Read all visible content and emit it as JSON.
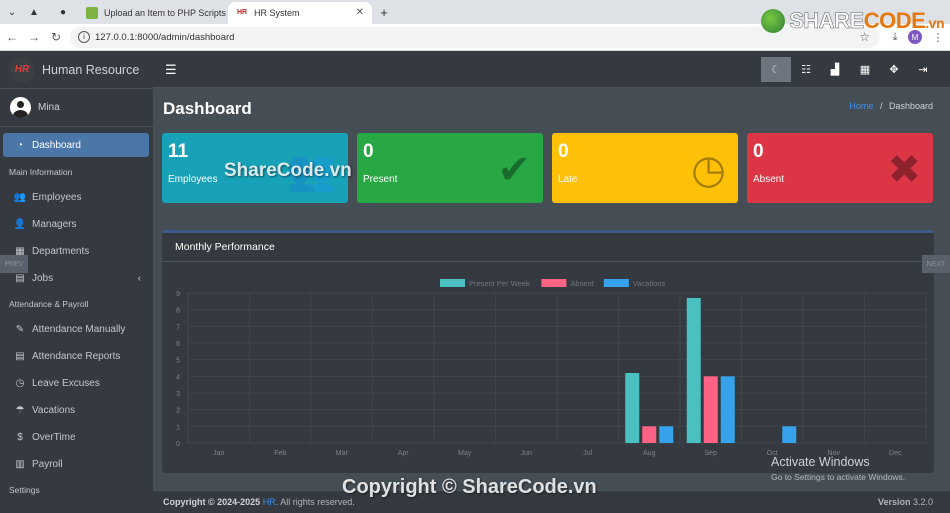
{
  "browser": {
    "tabs": [
      {
        "title": "Upload an Item to PHP Scripts |",
        "active": false
      },
      {
        "title": "HR System",
        "active": true
      }
    ],
    "url": "127.0.0.1:8000/admin/dashboard",
    "new_tab": "+"
  },
  "watermark_logo": {
    "brand_a": "SHARE",
    "brand_b": "CODE",
    "suffix": ".vn"
  },
  "sidebar": {
    "brand_logo": "HR",
    "brand": "Human Resource",
    "user": "Mina",
    "dashboard": "Dashboard",
    "sections": [
      {
        "header": "Main Information",
        "items": [
          "Employees",
          "Managers",
          "Departments",
          "Jobs"
        ]
      },
      {
        "header": "Attendance & Payroll",
        "items": [
          "Attendance Manually",
          "Attendance Reports",
          "Leave Excuses",
          "Vacations",
          "OverTime",
          "Payroll"
        ]
      },
      {
        "header": "Settings",
        "items": []
      }
    ],
    "icons": {
      "dashboard": "gauge-icon",
      "employees": "users-icon",
      "managers": "user-tie-icon",
      "departments": "building-icon",
      "jobs": "briefcase-icon"
    }
  },
  "navbar": {
    "buttons": [
      "moon-icon",
      "tasks-icon",
      "chart-icon",
      "calendar-icon",
      "expand-icon",
      "logout-icon"
    ]
  },
  "page": {
    "title": "Dashboard",
    "breadcrumb": {
      "home": "Home",
      "sep": "/",
      "current": "Dashboard"
    }
  },
  "stats": [
    {
      "value": "11",
      "label": "Employees",
      "color": "#17a2b8",
      "icon": "users-icon"
    },
    {
      "value": "0",
      "label": "Present",
      "color": "#28a745",
      "icon": "check-icon"
    },
    {
      "value": "0",
      "label": "Late",
      "color": "#ffc107",
      "icon": "clock-icon"
    },
    {
      "value": "0",
      "label": "Absent",
      "color": "#dc3545",
      "icon": "times-icon"
    }
  ],
  "chart_card": {
    "title": "Monthly Performance"
  },
  "chart_data": {
    "type": "bar",
    "categories": [
      "Jan",
      "Feb",
      "Mar",
      "Apr",
      "May",
      "Jun",
      "Jul",
      "Aug",
      "Sep",
      "Oct",
      "Nov",
      "Dec"
    ],
    "series": [
      {
        "name": "Present Per Week",
        "color": "#4bc0c0",
        "values": [
          0,
          0,
          0,
          0,
          0,
          0,
          0,
          4.2,
          8.7,
          0,
          0,
          0
        ]
      },
      {
        "name": "Absent",
        "color": "#ff6384",
        "values": [
          0,
          0,
          0,
          0,
          0,
          0,
          0,
          1,
          4,
          0,
          0,
          0
        ]
      },
      {
        "name": "Vacations",
        "color": "#36a2eb",
        "values": [
          0,
          0,
          0,
          0,
          0,
          0,
          0,
          1,
          4,
          1,
          0,
          0
        ]
      }
    ],
    "ylim": [
      0,
      9
    ],
    "yticks": [
      "0",
      "1",
      "2",
      "3",
      "4",
      "5",
      "6",
      "7",
      "8",
      "9"
    ],
    "legend": "top-center",
    "grid": true
  },
  "footer": {
    "copyright_prefix": "Copyright © 2024-2025",
    "brand": "HR",
    "suffix": ". All rights reserved.",
    "version_label": "Version",
    "version": "3.2.0"
  },
  "side_tabs": {
    "prev": "PREV",
    "next": "NEXT"
  },
  "windows": {
    "activate": "Activate Windows",
    "hint": "Go to Settings to activate Windows."
  },
  "watermarks": {
    "center": "ShareCode.vn",
    "bottom": "Copyright © ShareCode.vn"
  }
}
